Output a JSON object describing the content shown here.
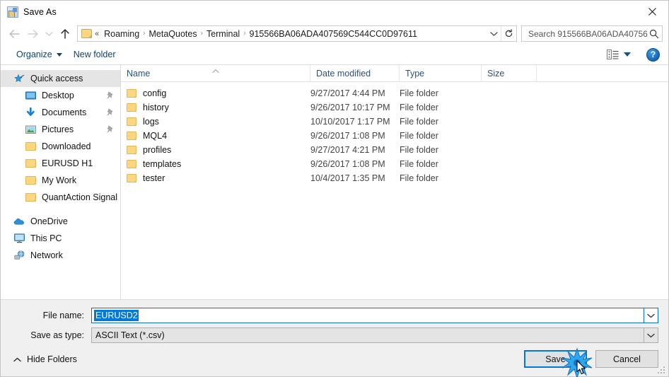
{
  "window": {
    "title": "Save As",
    "icon": "app-icon",
    "close_label": "Close"
  },
  "nav": {
    "back": "Back",
    "forward": "Forward",
    "recent": "Recent locations",
    "up": "Up to Terminal",
    "refresh": "Refresh",
    "breadcrumb_prefix": "«",
    "breadcrumb": [
      "Roaming",
      "MetaQuotes",
      "Terminal",
      "915566BA06ADA407569C544CC0D97611"
    ],
    "breadcrumb_separator": "›"
  },
  "search": {
    "placeholder": "Search 915566BA06ADA40756...",
    "value": "",
    "icon": "search-icon"
  },
  "toolbar": {
    "organize": "Organize",
    "new_folder": "New folder",
    "view_icon": "list-view-icon",
    "help_label": "?"
  },
  "sidebar": {
    "groups": [
      {
        "name": "quick-access",
        "header": {
          "label": "Quick access",
          "icon": "star-pin-icon",
          "selected": true
        },
        "items": [
          {
            "label": "Desktop",
            "icon": "desktop-icon",
            "pinned": true
          },
          {
            "label": "Documents",
            "icon": "documents-icon",
            "pinned": true
          },
          {
            "label": "Pictures",
            "icon": "pictures-icon",
            "pinned": true
          },
          {
            "label": "Downloaded",
            "icon": "folder-icon",
            "pinned": false
          },
          {
            "label": "EURUSD H1",
            "icon": "folder-icon",
            "pinned": false
          },
          {
            "label": "My Work",
            "icon": "folder-icon",
            "pinned": false
          },
          {
            "label": "QuantAction Signal",
            "icon": "folder-icon",
            "pinned": false
          }
        ]
      },
      {
        "name": "locations",
        "header": null,
        "items": [
          {
            "label": "OneDrive",
            "icon": "onedrive-cloud-icon",
            "pinned": false
          },
          {
            "label": "This PC",
            "icon": "this-pc-icon",
            "pinned": false
          },
          {
            "label": "Network",
            "icon": "network-icon",
            "pinned": false
          }
        ]
      }
    ]
  },
  "filelist": {
    "columns": [
      {
        "key": "name",
        "label": "Name",
        "sorted": "asc"
      },
      {
        "key": "date",
        "label": "Date modified",
        "sorted": null
      },
      {
        "key": "type",
        "label": "Type",
        "sorted": null
      },
      {
        "key": "size",
        "label": "Size",
        "sorted": null
      }
    ],
    "rows": [
      {
        "name": "config",
        "date": "9/27/2017 4:44 PM",
        "type": "File folder",
        "size": ""
      },
      {
        "name": "history",
        "date": "9/26/2017 10:17 PM",
        "type": "File folder",
        "size": ""
      },
      {
        "name": "logs",
        "date": "10/10/2017 1:17 PM",
        "type": "File folder",
        "size": ""
      },
      {
        "name": "MQL4",
        "date": "9/26/2017 1:08 PM",
        "type": "File folder",
        "size": ""
      },
      {
        "name": "profiles",
        "date": "9/27/2017 4:21 PM",
        "type": "File folder",
        "size": ""
      },
      {
        "name": "templates",
        "date": "9/26/2017 1:08 PM",
        "type": "File folder",
        "size": ""
      },
      {
        "name": "tester",
        "date": "10/4/2017 1:35 PM",
        "type": "File folder",
        "size": ""
      }
    ]
  },
  "footer": {
    "file_name_label": "File name:",
    "file_name_value": "EURUSD2",
    "save_as_type_label": "Save as type:",
    "save_as_type_value": "ASCII Text (*.csv)",
    "hide_folders": "Hide Folders",
    "save_button": "Save",
    "cancel_button": "Cancel"
  },
  "colors": {
    "accent": "#0078d7",
    "selection": "#0078d7",
    "folder": "#fcd77f",
    "link_text": "#12436b",
    "column_header_text": "#2b5278",
    "footer_bg": "#f0f0f0"
  }
}
